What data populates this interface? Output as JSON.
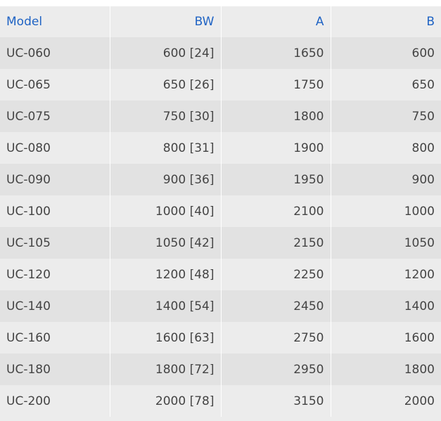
{
  "table": {
    "headers": [
      "Model",
      "BW",
      "A",
      "B"
    ],
    "rows": [
      [
        "UC-060",
        "600 [24]",
        "1650",
        "600"
      ],
      [
        "UC-065",
        "650 [26]",
        "1750",
        "650"
      ],
      [
        "UC-075",
        "750 [30]",
        "1800",
        "750"
      ],
      [
        "UC-080",
        "800 [31]",
        "1900",
        "800"
      ],
      [
        "UC-090",
        "900 [36]",
        "1950",
        "900"
      ],
      [
        "UC-100",
        "1000 [40]",
        "2100",
        "1000"
      ],
      [
        "UC-105",
        "1050 [42]",
        "2150",
        "1050"
      ],
      [
        "UC-120",
        "1200 [48]",
        "2250",
        "1200"
      ],
      [
        "UC-140",
        "1400 [54]",
        "2450",
        "1400"
      ],
      [
        "UC-160",
        "1600 [63]",
        "2750",
        "1600"
      ],
      [
        "UC-180",
        "1800 [72]",
        "2950",
        "1800"
      ],
      [
        "UC-200",
        "2000 [78]",
        "3150",
        "2000"
      ]
    ]
  },
  "colors": {
    "header_text": "#1f63c4",
    "body_text": "#444444",
    "row_odd": "#e2e2e2",
    "row_even": "#ececec"
  }
}
